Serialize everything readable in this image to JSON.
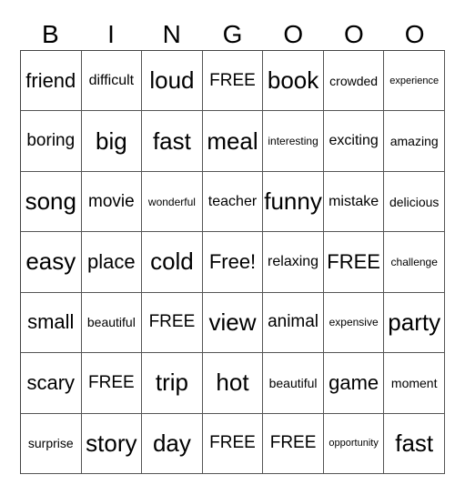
{
  "header": [
    "B",
    "I",
    "N",
    "G",
    "O",
    "O",
    "O"
  ],
  "board": [
    [
      {
        "text": "friend",
        "size": "s-l"
      },
      {
        "text": "difficult",
        "size": "s-sm"
      },
      {
        "text": "loud",
        "size": "s-xl"
      },
      {
        "text": "FREE",
        "size": "s-m"
      },
      {
        "text": "book",
        "size": "s-xl"
      },
      {
        "text": "crowded",
        "size": "s-s"
      },
      {
        "text": "experience",
        "size": "s-xxs"
      }
    ],
    [
      {
        "text": "boring",
        "size": "s-m"
      },
      {
        "text": "big",
        "size": "s-xl"
      },
      {
        "text": "fast",
        "size": "s-xl"
      },
      {
        "text": "meal",
        "size": "s-xl"
      },
      {
        "text": "interesting",
        "size": "s-xs"
      },
      {
        "text": "exciting",
        "size": "s-sm"
      },
      {
        "text": "amazing",
        "size": "s-s"
      }
    ],
    [
      {
        "text": "song",
        "size": "s-xl"
      },
      {
        "text": "movie",
        "size": "s-m"
      },
      {
        "text": "wonderful",
        "size": "s-xs"
      },
      {
        "text": "teacher",
        "size": "s-sm"
      },
      {
        "text": "funny",
        "size": "s-xl"
      },
      {
        "text": "mistake",
        "size": "s-sm"
      },
      {
        "text": "delicious",
        "size": "s-s"
      }
    ],
    [
      {
        "text": "easy",
        "size": "s-xl"
      },
      {
        "text": "place",
        "size": "s-l"
      },
      {
        "text": "cold",
        "size": "s-xl"
      },
      {
        "text": "Free!",
        "size": "s-l"
      },
      {
        "text": "relaxing",
        "size": "s-sm"
      },
      {
        "text": "FREE",
        "size": "s-l"
      },
      {
        "text": "challenge",
        "size": "s-xs"
      }
    ],
    [
      {
        "text": "small",
        "size": "s-l"
      },
      {
        "text": "beautiful",
        "size": "s-s"
      },
      {
        "text": "FREE",
        "size": "s-m"
      },
      {
        "text": "view",
        "size": "s-xl"
      },
      {
        "text": "animal",
        "size": "s-m"
      },
      {
        "text": "expensive",
        "size": "s-xs"
      },
      {
        "text": "party",
        "size": "s-xl"
      }
    ],
    [
      {
        "text": "scary",
        "size": "s-l"
      },
      {
        "text": "FREE",
        "size": "s-m"
      },
      {
        "text": "trip",
        "size": "s-xl"
      },
      {
        "text": "hot",
        "size": "s-xl"
      },
      {
        "text": "beautiful",
        "size": "s-s"
      },
      {
        "text": "game",
        "size": "s-l"
      },
      {
        "text": "moment",
        "size": "s-s"
      }
    ],
    [
      {
        "text": "surprise",
        "size": "s-s"
      },
      {
        "text": "story",
        "size": "s-xl"
      },
      {
        "text": "day",
        "size": "s-xl"
      },
      {
        "text": "FREE",
        "size": "s-m"
      },
      {
        "text": "FREE",
        "size": "s-m"
      },
      {
        "text": "opportunity",
        "size": "s-xxs"
      },
      {
        "text": "fast",
        "size": "s-xl"
      }
    ]
  ]
}
